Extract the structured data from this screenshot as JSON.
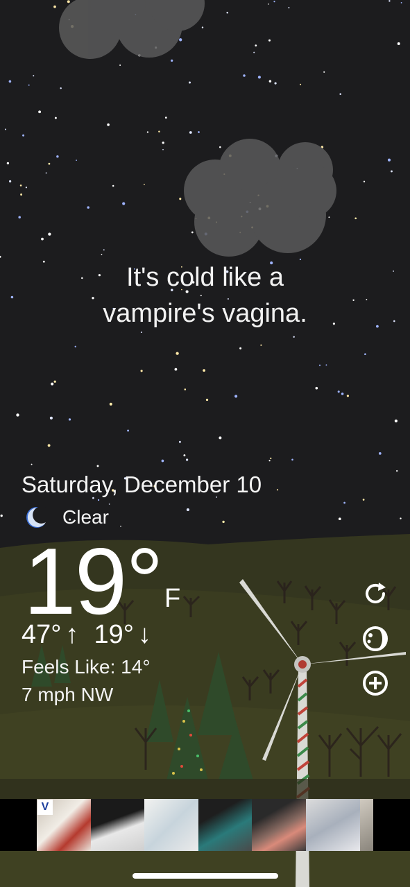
{
  "quote": {
    "line1": "It's cold like a",
    "line2": "vampire's vagina."
  },
  "weather": {
    "date": "Saturday, December 10",
    "condition": "Clear",
    "condition_icon": "moon-icon",
    "temperature": "19°",
    "unit": "F",
    "high": "47°",
    "high_arrow": "↑",
    "low": "19°",
    "low_arrow": "↓",
    "feels_like": "Feels Like: 14°",
    "wind": "7 mph NW"
  },
  "actions": {
    "refresh_icon": "refresh-icon",
    "theme_icon": "theme-icon",
    "add_icon": "add-location-icon"
  },
  "ad": {
    "logo": "V",
    "tiles": [
      "sneaker-1",
      "sneaker-2",
      "sneaker-3",
      "sneaker-4",
      "sneaker-5",
      "sneaker-6",
      "sneaker-7"
    ]
  },
  "colors": {
    "sky": "#1c1c1e",
    "ground": "#3d3e22",
    "tree": "#2f4a2a"
  }
}
